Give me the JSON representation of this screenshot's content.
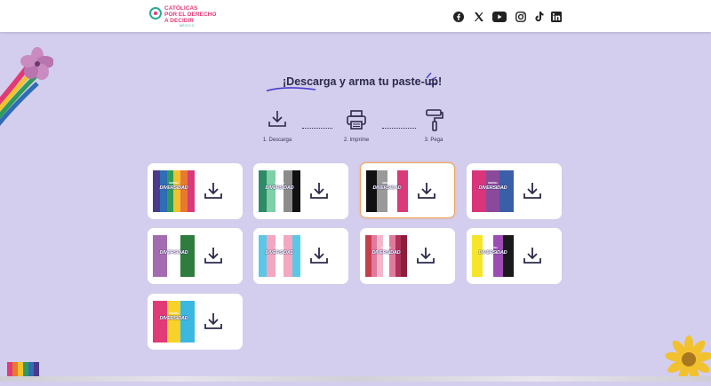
{
  "header": {
    "logo": {
      "text": "CATÓLICAS\nPOR EL DERECHO\nA DECIDIR",
      "subtext": "MÉXICO"
    },
    "social_icons": [
      "facebook-icon",
      "x-icon",
      "youtube-icon",
      "instagram-icon",
      "tiktok-icon",
      "linkedin-icon"
    ]
  },
  "main": {
    "title": "¡Descarga y arma tu paste-up!",
    "steps": [
      {
        "label": "1. Descarga",
        "icon": "download-icon"
      },
      {
        "label": "2. Imprime",
        "icon": "printer-icon"
      },
      {
        "label": "3. Pega",
        "icon": "paint-roller-icon"
      }
    ],
    "cards": [
      {
        "kicker": "SEMANA",
        "label": "DIVERSIDAD",
        "colors": [
          "#4b3a8a",
          "#2f6db5",
          "#2e9b5a",
          "#f2c12e",
          "#e8792f",
          "#d83a7a"
        ]
      },
      {
        "kicker": "SEMANA",
        "label": "DIVERSIDAD",
        "colors": [
          "#2e8b67",
          "#7fcfa7",
          "#ffffff",
          "#8c8c8c",
          "#111111"
        ]
      },
      {
        "kicker": "SEMANA",
        "label": "DIVERSIDAD",
        "colors": [
          "#111111",
          "#9a9a9a",
          "#ffffff",
          "#d83a7a"
        ]
      },
      {
        "kicker": "SEMANA",
        "label": "DIVERSIDAD",
        "colors": [
          "#d8357a",
          "#8a4a9b",
          "#3a5fa8"
        ]
      },
      {
        "kicker": "SEMANA",
        "label": "DIVERSIDAD",
        "colors": [
          "#a46cb0",
          "#ffffff",
          "#2e7d3e"
        ]
      },
      {
        "kicker": "SEMANA",
        "label": "DIVERSIDAD",
        "colors": [
          "#5bc8e8",
          "#f3a8c0",
          "#ffffff",
          "#f3a8c0",
          "#5bc8e8"
        ]
      },
      {
        "kicker": "SEMANA",
        "label": "DIVERSIDAD",
        "colors": [
          "#c43f4e",
          "#e07a9e",
          "#f1b8cb",
          "#ffffff",
          "#e07a9e",
          "#b0305a",
          "#8a1f3a"
        ]
      },
      {
        "kicker": "SEMANA",
        "label": "DIVERSIDAD",
        "colors": [
          "#f6e62a",
          "#ffffff",
          "#9b4db3",
          "#1a1a1a"
        ]
      },
      {
        "kicker": "SEMANA",
        "label": "DIVERSIDAD",
        "colors": [
          "#e23a77",
          "#f6d22a",
          "#3bb8e0"
        ]
      }
    ],
    "active_card_index": 2,
    "download_icon": "download-icon"
  },
  "colors": {
    "background": "#d3cdee",
    "accent_pink": "#e23a77",
    "accent_teal": "#2fa996",
    "active_border": "#f0a55a",
    "text_dark": "#2c2a4a"
  }
}
